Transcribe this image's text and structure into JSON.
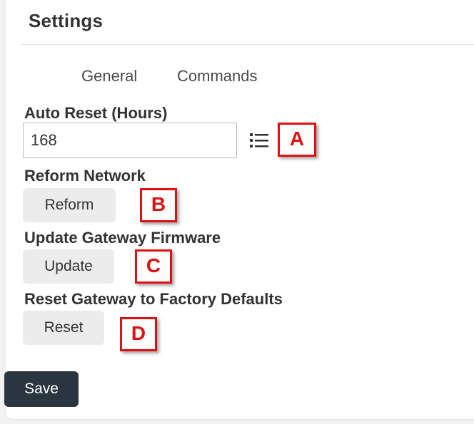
{
  "settings": {
    "title": "Settings",
    "tabs": [
      {
        "label": "General"
      },
      {
        "label": "Commands"
      }
    ],
    "auto_reset": {
      "label": "Auto Reset (Hours)",
      "value": "168"
    },
    "reform": {
      "label": "Reform Network",
      "button": "Reform"
    },
    "update": {
      "label": "Update Gateway Firmware",
      "button": "Update"
    },
    "factory_reset": {
      "label": "Reset Gateway to Factory Defaults",
      "button": "Reset"
    },
    "save_label": "Save"
  },
  "markers": [
    "A",
    "B",
    "C",
    "D"
  ],
  "colors": {
    "marker": "#e01010",
    "save_button": "#2a3540",
    "button_bg": "#ececec"
  },
  "icons": {
    "options_list": "list-icon"
  }
}
